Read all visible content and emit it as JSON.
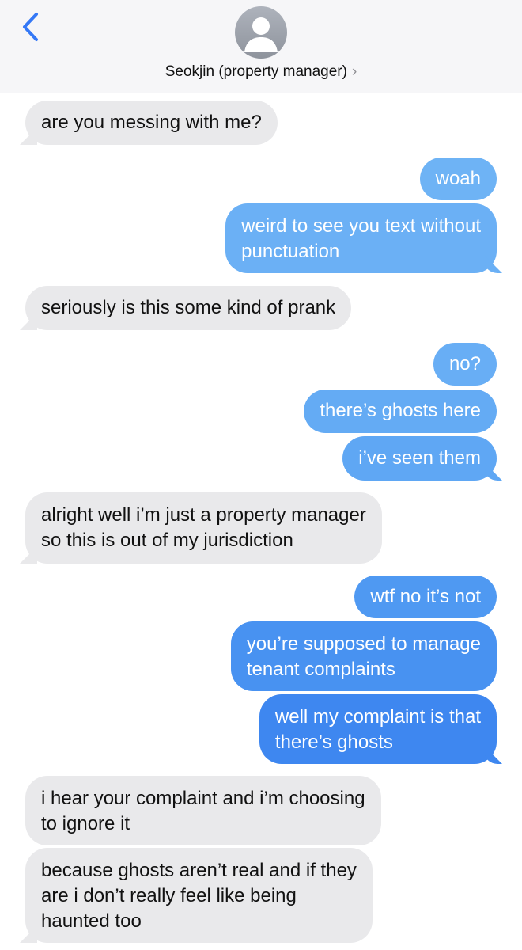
{
  "header": {
    "contact_name": "Seokjin (property manager)",
    "chevron": "›",
    "back_icon": "chevron-left-icon",
    "avatar_icon": "person-silhouette-icon"
  },
  "colors": {
    "accent": "#3478f6",
    "received_bubble": "#e9e9eb",
    "sent_top": "#6fb4f6",
    "sent_bottom": "#3d85f0"
  },
  "messages": [
    {
      "from": "them",
      "text": "are you messing with me?"
    },
    {
      "from": "me",
      "text": "woah"
    },
    {
      "from": "me",
      "line1": "weird to see you text without",
      "line2": "punctuation"
    },
    {
      "from": "them",
      "text": "seriously is this some kind of prank"
    },
    {
      "from": "me",
      "text": "no?"
    },
    {
      "from": "me",
      "text": "there’s ghosts here"
    },
    {
      "from": "me",
      "text": "i’ve seen them"
    },
    {
      "from": "them",
      "line1": "alright well i’m just a property manager",
      "line2": "so this is out of my jurisdiction"
    },
    {
      "from": "me",
      "text": "wtf no it’s not"
    },
    {
      "from": "me",
      "line1": "you’re supposed to manage",
      "line2": "tenant complaints"
    },
    {
      "from": "me",
      "line1": "well my complaint is that",
      "line2": "there’s ghosts"
    },
    {
      "from": "them",
      "line1": "i hear your complaint and i’m choosing",
      "line2": "to ignore it"
    },
    {
      "from": "them",
      "line1": "because ghosts aren’t real and if they",
      "line2": "are i don’t really feel like being",
      "line3": "haunted too"
    }
  ]
}
